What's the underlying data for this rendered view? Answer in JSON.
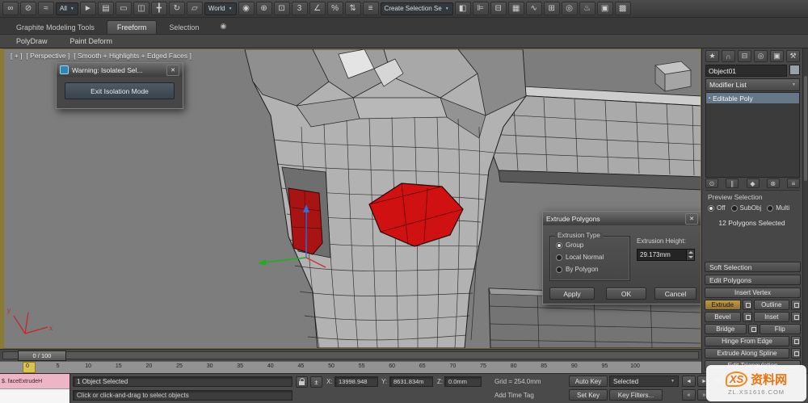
{
  "icons": {
    "close": "✕",
    "dropdown_arrow": "▼",
    "abs_offset": "±",
    "ribbon_options": "◉",
    "stack_item": "▪"
  },
  "toolbar": {
    "items": [
      {
        "name": "select-and-link-icon",
        "glyph": "∞"
      },
      {
        "name": "unlink-selection-icon",
        "glyph": "⊘"
      },
      {
        "name": "bind-to-space-warp-icon",
        "glyph": "≈"
      },
      {
        "name": "selection-filter-dropdown",
        "type": "dropdown",
        "label": "All"
      },
      {
        "name": "select-object-icon",
        "glyph": "►"
      },
      {
        "name": "select-by-name-icon",
        "glyph": "▤"
      },
      {
        "name": "selection-region-icon",
        "glyph": "▭"
      },
      {
        "name": "window-crossing-icon",
        "glyph": "◫"
      },
      {
        "name": "select-and-move-icon",
        "glyph": "╋"
      },
      {
        "name": "select-and-rotate-icon",
        "glyph": "↻"
      },
      {
        "name": "select-and-scale-icon",
        "glyph": "▱"
      },
      {
        "name": "reference-coordinate-dropdown",
        "type": "dropdown",
        "label": "World"
      },
      {
        "name": "use-pivot-point-icon",
        "glyph": "◉"
      },
      {
        "name": "select-and-manipulate-icon",
        "glyph": "⊕"
      },
      {
        "name": "keyboard-shortcut-override-icon",
        "glyph": "⊡"
      },
      {
        "name": "snaps-toggle-icon",
        "glyph": "3"
      },
      {
        "name": "angle-snap-icon",
        "glyph": "∠"
      },
      {
        "name": "percent-snap-icon",
        "glyph": "%"
      },
      {
        "name": "spinner-snap-icon",
        "glyph": "⇅"
      },
      {
        "name": "edit-named-selection-sets-icon",
        "glyph": "≡"
      },
      {
        "name": "named-selection-set-dropdown",
        "type": "dropdown",
        "label": "Create Selection Se"
      },
      {
        "name": "mirror-icon",
        "glyph": "◧"
      },
      {
        "name": "align-icon",
        "glyph": "⊫"
      },
      {
        "name": "layer-manager-icon",
        "glyph": "⊟"
      },
      {
        "name": "graphite-ribbon-toggle-icon",
        "glyph": "▦"
      },
      {
        "name": "curve-editor-icon",
        "glyph": "∿"
      },
      {
        "name": "schematic-view-icon",
        "glyph": "⊞"
      },
      {
        "name": "material-editor-icon",
        "glyph": "◎"
      },
      {
        "name": "render-setup-icon",
        "glyph": "♨"
      },
      {
        "name": "rendered-frame-window-icon",
        "glyph": "▣"
      },
      {
        "name": "render-production-icon",
        "glyph": "▩"
      }
    ]
  },
  "ribbon": {
    "tabs": [
      {
        "label": "Graphite Modeling Tools"
      },
      {
        "label": "Freeform"
      },
      {
        "label": "Selection"
      }
    ],
    "panels": [
      {
        "label": "PolyDraw"
      },
      {
        "label": "Paint Deform"
      }
    ]
  },
  "viewport": {
    "menu_general": "[ + ]",
    "menu_pov": "[ Perspective ]",
    "menu_shading": "[ Smooth + Highlights + Edged Faces ]",
    "axis_x": "x",
    "axis_y": "y"
  },
  "warning_dialog": {
    "title": "Warning: Isolated Sel...",
    "button": "Exit Isolation Mode"
  },
  "extrude_dialog": {
    "title": "Extrude Polygons",
    "group": "Extrusion Type",
    "options": [
      {
        "label": "Group",
        "selected": true
      },
      {
        "label": "Local Normal",
        "selected": false
      },
      {
        "label": "By Polygon",
        "selected": false
      }
    ],
    "height_label": "Extrusion Height:",
    "height_value": "29.173mm",
    "apply": "Apply",
    "ok": "OK",
    "cancel": "Cancel"
  },
  "command_panel": {
    "tabs": [
      {
        "name": "create-tab-icon",
        "glyph": "★"
      },
      {
        "name": "modify-tab-icon",
        "glyph": "∩"
      },
      {
        "name": "hierarchy-tab-icon",
        "glyph": "⊟"
      },
      {
        "name": "motion-tab-icon",
        "glyph": "◎"
      },
      {
        "name": "display-tab-icon",
        "glyph": "▣"
      },
      {
        "name": "utilities-tab-icon",
        "glyph": "⚒"
      }
    ],
    "object_name": "Object01",
    "modifier_list": "Modifier List",
    "stack_selected": "Editable Poly",
    "stack_tools": [
      {
        "name": "pin-stack-icon",
        "glyph": "⊙"
      },
      {
        "name": "show-end-result-icon",
        "glyph": "∥"
      },
      {
        "name": "make-unique-icon",
        "glyph": "◆"
      },
      {
        "name": "remove-modifier-icon",
        "glyph": "⊗"
      },
      {
        "name": "configure-modifier-sets-icon",
        "glyph": "≡"
      }
    ],
    "preview_selection": {
      "title": "Preview Selection",
      "options": [
        {
          "label": "Off",
          "selected": true
        },
        {
          "label": "SubObj",
          "selected": false
        },
        {
          "label": "Multi",
          "selected": false
        }
      ]
    },
    "selection_status": "12 Polygons Selected",
    "soft_selection": "Soft Selection",
    "edit_polygons": "Edit Polygons",
    "buttons": {
      "insert_vertex": "Insert Vertex",
      "extrude": "Extrude",
      "outline": "Outline",
      "bevel": "Bevel",
      "inset": "Inset",
      "bridge": "Bridge",
      "flip": "Flip",
      "hinge": "Hinge From Edge",
      "extrude_spline": "Extrude Along Spline",
      "edit_tri": "Edit Triangulation"
    }
  },
  "timeline": {
    "slider_label": "0 / 100",
    "ticks": [
      "0",
      "5",
      "10",
      "15",
      "20",
      "25",
      "30",
      "35",
      "40",
      "45",
      "50",
      "55",
      "60",
      "65",
      "70",
      "75",
      "80",
      "85",
      "90",
      "95",
      "100"
    ]
  },
  "playback": {
    "row1": [
      {
        "name": "previous-key-button",
        "glyph": "◄"
      },
      {
        "name": "play-animation-button",
        "glyph": "►"
      },
      {
        "name": "next-key-button",
        "glyph": "»"
      }
    ],
    "row2": [
      {
        "name": "go-to-start-button",
        "glyph": "«"
      },
      {
        "name": "go-to-end-button",
        "glyph": "»"
      }
    ]
  },
  "status_bar": {
    "listener_macro": "$. faceExtrudeH",
    "selection_info": "1 Object Selected",
    "prompt": "Click or click-and-drag to select objects",
    "x_label": "X:",
    "x_value": "13998.948",
    "y_label": "Y:",
    "y_value": "8631.834m",
    "z_label": "Z:",
    "z_value": "0.0mm",
    "grid": "Grid = 254.0mm",
    "add_time_tag": "Add Time Tag",
    "auto_key": "Auto Key",
    "set_key": "Set Key",
    "selection_set": "Selected",
    "key_filters": "Key Filters..."
  },
  "watermark": {
    "logo": "XS",
    "site": "资料网",
    "url": "ZL.XS1616.COM"
  }
}
